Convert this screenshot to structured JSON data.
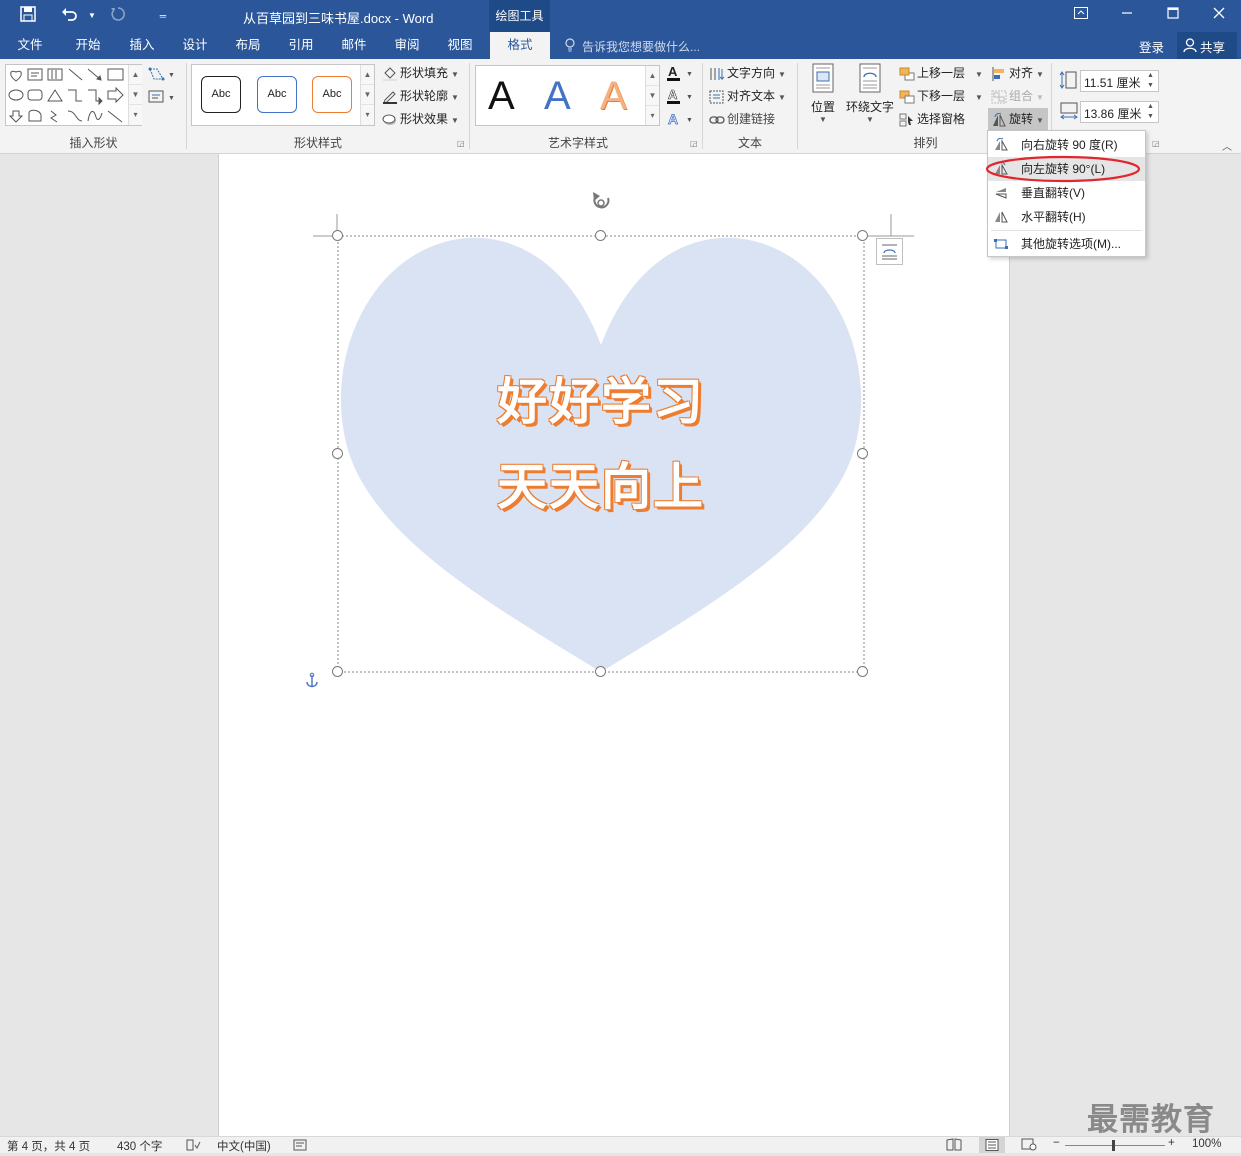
{
  "title_bar": {
    "doc_title": "从百草园到三味书屋.docx - Word",
    "context_tab": "绘图工具",
    "accent": "#2b579a"
  },
  "tabs": [
    "文件",
    "开始",
    "插入",
    "设计",
    "布局",
    "引用",
    "邮件",
    "审阅",
    "视图",
    "格式"
  ],
  "active_tab": "格式",
  "tell_me": "告诉我您想要做什么...",
  "signin": "登录",
  "share": "共享",
  "ribbon": {
    "insert_shapes_label": "插入形状",
    "shape_styles": {
      "label": "形状样式",
      "samples": [
        "Abc",
        "Abc",
        "Abc"
      ],
      "fill": "形状填充",
      "outline": "形状轮廓",
      "effects": "形状效果"
    },
    "wordart": {
      "label": "艺术字样式",
      "samples": [
        "A",
        "A",
        "A"
      ]
    },
    "text": {
      "label": "文本",
      "direction": "文字方向",
      "align": "对齐文本",
      "link": "创建链接"
    },
    "arrange": {
      "label": "排列",
      "position": "位置",
      "wrap": "环绕文字",
      "bring_forward": "上移一层",
      "send_backward": "下移一层",
      "selection_pane": "选择窗格",
      "align": "对齐",
      "group": "组合",
      "rotate": "旋转"
    },
    "size": {
      "height": "11.51 厘米",
      "width": "13.86 厘米"
    }
  },
  "rotate_menu": [
    "向右旋转 90 度(R)",
    "向左旋转 90°(L)",
    "垂直翻转(V)",
    "水平翻转(H)",
    "其他旋转选项(M)..."
  ],
  "document": {
    "wordart_line1": "好好学习",
    "wordart_line2": "天天向上",
    "heart_fill": "#dae3f3",
    "text_color": "#ed7d31"
  },
  "status": {
    "page": "第 4 页，共 4 页",
    "words": "430 个字",
    "lang": "中文(中国)",
    "zoom": "100%"
  },
  "watermark": "最需教育"
}
